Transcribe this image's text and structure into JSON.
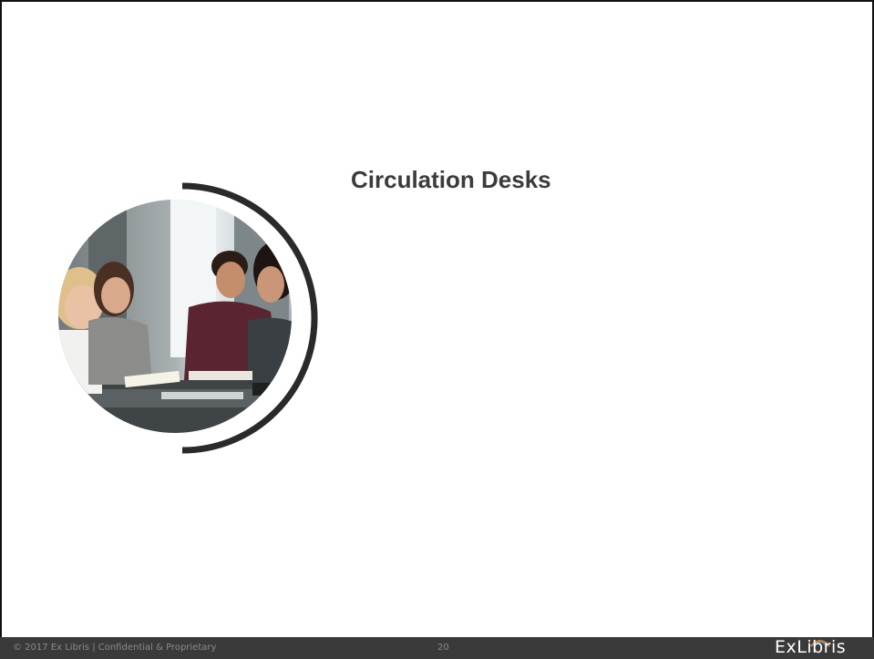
{
  "slide": {
    "title": "Circulation Desks",
    "image_icon": "students-studying-photo-icon"
  },
  "footer": {
    "copyright": "© 2017 Ex Libris | Confidential & Proprietary",
    "page_number": "20",
    "logo": "ExLibris"
  },
  "colors": {
    "title": "#3b3b3b",
    "footer_bg": "#3a3a3a",
    "footer_text": "#8a8a8a",
    "arc": "#2a2a2a"
  }
}
